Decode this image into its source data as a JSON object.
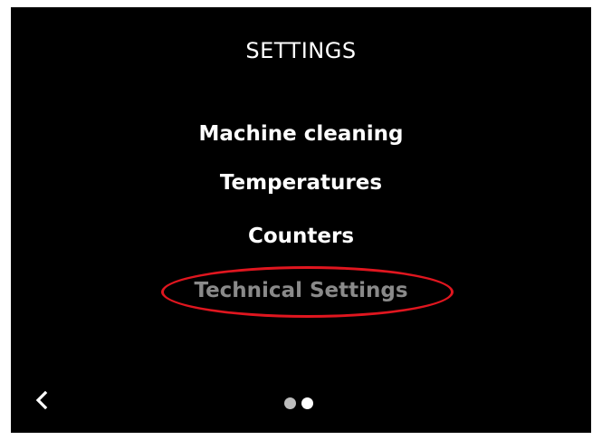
{
  "screen": {
    "title": "SETTINGS",
    "menu": [
      {
        "label": "Machine cleaning",
        "state": "normal"
      },
      {
        "label": "Temperatures",
        "state": "normal"
      },
      {
        "label": "Counters",
        "state": "normal"
      },
      {
        "label": "Technical Settings",
        "state": "disabled"
      }
    ],
    "back_icon": "chevron-left-icon",
    "pager": {
      "pages": 2,
      "current": 2,
      "inactive_color": "#bdbdbd",
      "active_color": "#ffffff"
    }
  },
  "annotation": {
    "highlight_color": "#e0161f",
    "target": "Technical Settings"
  },
  "colors": {
    "background": "#000000",
    "text": "#ffffff",
    "disabled_text": "#8a8a8a"
  }
}
